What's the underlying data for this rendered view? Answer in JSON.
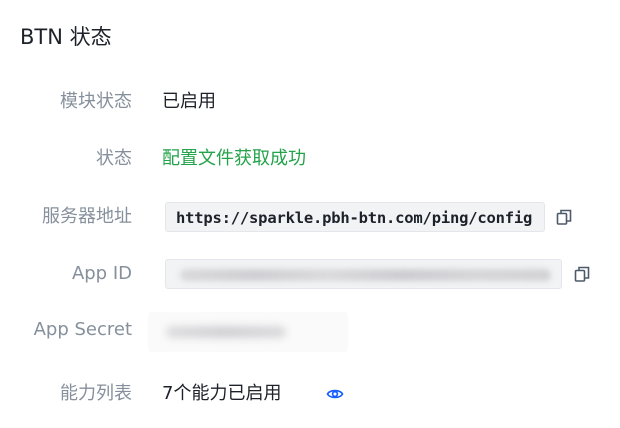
{
  "section": {
    "title": "BTN 状态"
  },
  "rows": {
    "module_status": {
      "label": "模块状态",
      "value": "已启用"
    },
    "status": {
      "label": "状态",
      "value": "配置文件获取成功"
    },
    "server_address": {
      "label": "服务器地址",
      "value": "https://sparkle.pbh-btn.com/ping/config"
    },
    "app_id": {
      "label": "App ID"
    },
    "app_secret": {
      "label": "App Secret"
    },
    "capabilities": {
      "label": "能力列表",
      "value": "7个能力已启用"
    }
  },
  "icons": {
    "copy": "copy-icon",
    "eye": "eye-icon"
  },
  "colors": {
    "success": "#23a34a",
    "accent": "#165dff",
    "label": "#86909c",
    "text": "#1d2129"
  }
}
